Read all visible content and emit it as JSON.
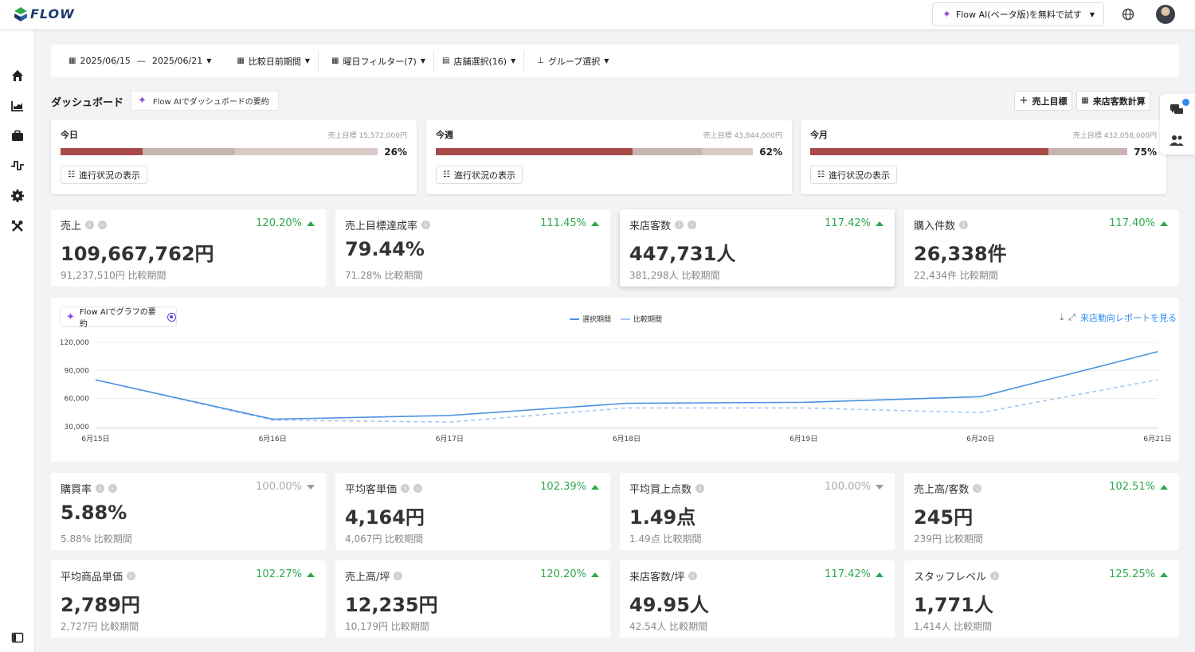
{
  "app": {
    "logo_text": "FLOW",
    "ai_trial_label": "Flow AI(ベータ版)を無料で試す"
  },
  "filters": {
    "date_start": "2025/06/15",
    "date_sep": "—",
    "date_end": "2025/06/21",
    "compare": "比較日前期間",
    "weekday": "曜日フィルター(7)",
    "stores": "店舗選択(16)",
    "group": "グループ選択"
  },
  "dashboard": {
    "title": "ダッシュボード",
    "summary_button": "Flow AIでダッシュボードの要約",
    "sales_target_button": "売上目標",
    "visitor_calc_button": "来店客数計算"
  },
  "progress_button_label": "進行状況の表示",
  "progress_cards": [
    {
      "label": "今日",
      "target": "売上目標 15,572,000円",
      "percent": "26%",
      "fill": 0.26,
      "fill_b": 0.55
    },
    {
      "label": "今週",
      "target": "売上目標 43,844,000円",
      "percent": "62%",
      "fill": 0.62,
      "fill_b": 0.84
    },
    {
      "label": "今月",
      "target": "売上目標 432,058,000円",
      "percent": "75%",
      "fill": 0.75,
      "fill_b": 1.0
    }
  ],
  "kpis": [
    {
      "label": "売上",
      "change": "120.20%",
      "trend": "up",
      "value": "109,667,762円",
      "compare": "91,237,510円 比較期間"
    },
    {
      "label": "売上目標達成率",
      "change": "111.45%",
      "trend": "up",
      "value": "79.44%",
      "compare": "71.28% 比較期間"
    },
    {
      "label": "来店客数",
      "change": "117.42%",
      "trend": "up",
      "value": "447,731人",
      "compare": "381,298人 比較期間"
    },
    {
      "label": "購入件数",
      "change": "117.40%",
      "trend": "up",
      "value": "26,338件",
      "compare": "22,434件 比較期間"
    },
    {
      "label": "購買率",
      "change": "100.00%",
      "trend": "flat",
      "value": "5.88%",
      "compare": "5.88% 比較期間"
    },
    {
      "label": "平均客単価",
      "change": "102.39%",
      "trend": "up",
      "value": "4,164円",
      "compare": "4,067円 比較期間"
    },
    {
      "label": "平均買上点数",
      "change": "100.00%",
      "trend": "flat",
      "value": "1.49点",
      "compare": "1.49点 比較期間"
    },
    {
      "label": "売上高/客数",
      "change": "102.51%",
      "trend": "up",
      "value": "245円",
      "compare": "239円 比較期間"
    },
    {
      "label": "平均商品単価",
      "change": "102.27%",
      "trend": "up",
      "value": "2,789円",
      "compare": "2,727円 比較期間"
    },
    {
      "label": "売上高/坪",
      "change": "120.20%",
      "trend": "up",
      "value": "12,235円",
      "compare": "10,179円 比較期間"
    },
    {
      "label": "来店客数/坪",
      "change": "117.42%",
      "trend": "up",
      "value": "49.95人",
      "compare": "42.54人 比較期間"
    },
    {
      "label": "スタッフレベル",
      "change": "125.25%",
      "trend": "up",
      "value": "1,771人",
      "compare": "1,414人 比較期間"
    }
  ],
  "chart": {
    "ai_button": "Flow AIでグラフの要約",
    "report_link": "来店動向レポートを見る",
    "colors": {
      "selected": "#4a90e2",
      "compare": "#a9c6f0",
      "progress": "#a84a4a"
    }
  },
  "chart_data": {
    "type": "line",
    "categories": [
      "6月15日",
      "6月16日",
      "6月17日",
      "6月18日",
      "6月19日",
      "6月20日",
      "6月21日"
    ],
    "series": [
      {
        "name": "選択期間",
        "values": [
          80000,
          38000,
          42000,
          55000,
          56000,
          62000,
          110000
        ]
      },
      {
        "name": "比較期間",
        "values": [
          80000,
          37000,
          35000,
          50000,
          50000,
          45000,
          80000
        ]
      }
    ],
    "yticks": [
      "120,000",
      "90,000",
      "60,000",
      "30,000"
    ],
    "ylim": [
      30000,
      120000
    ],
    "grid": true,
    "legend": "top-center"
  }
}
